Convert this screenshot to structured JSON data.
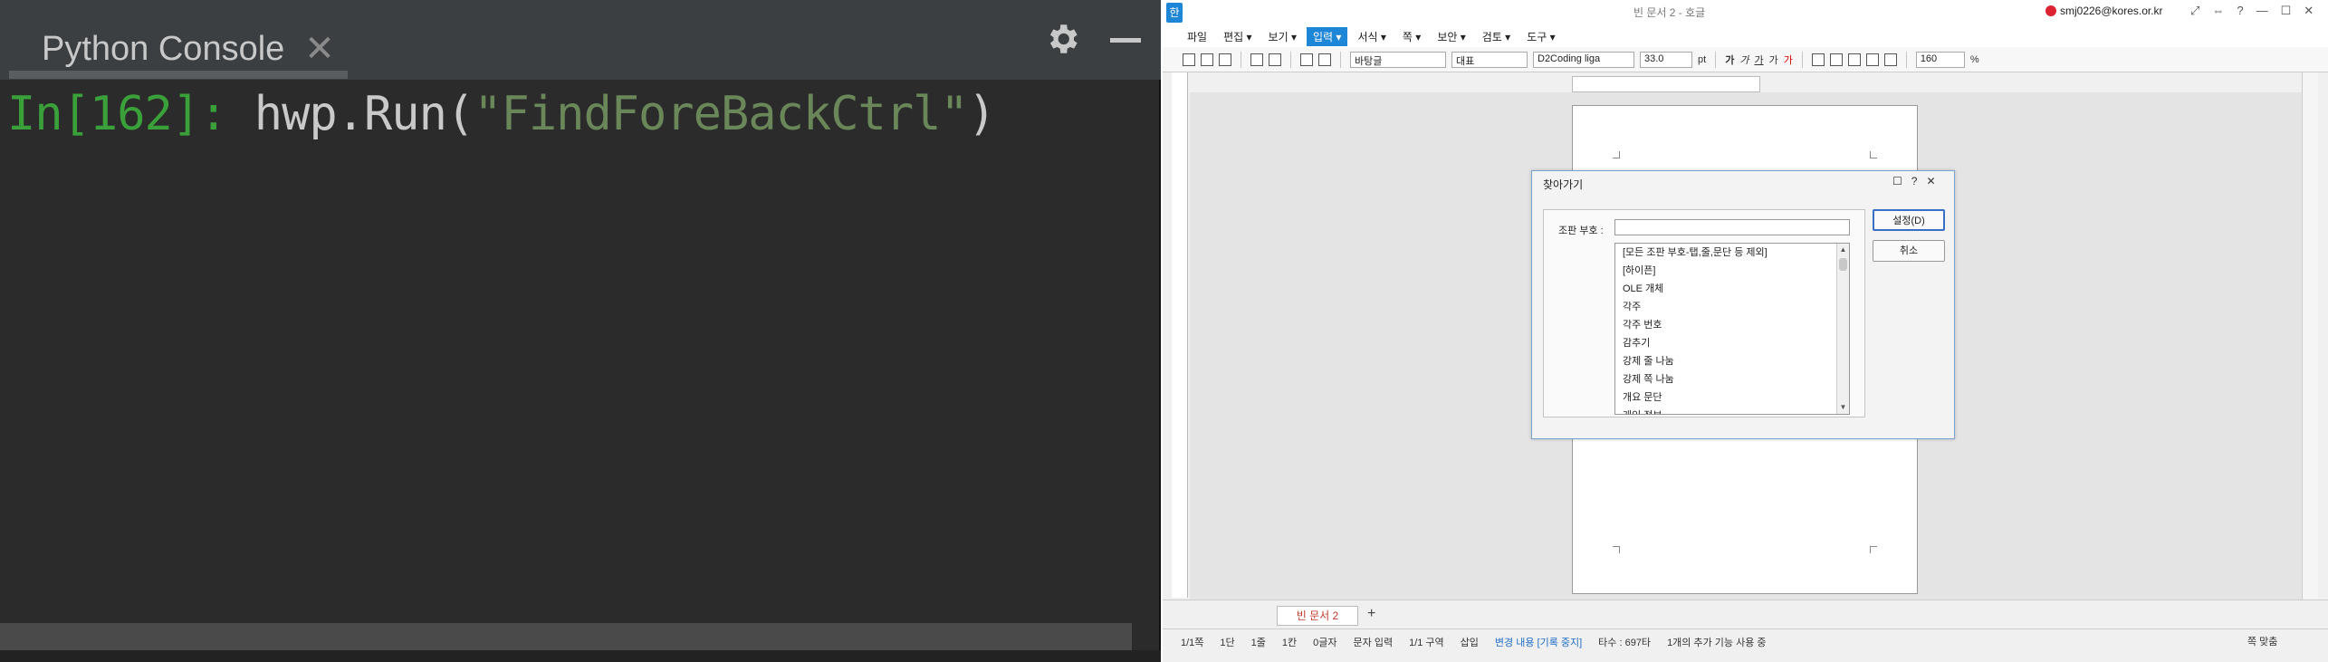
{
  "console": {
    "tab_title": "Python Console",
    "tab_close": "✕",
    "prompt": "In[162]:",
    "code_call": " hwp.Run(",
    "code_string": "\"FindForeBackCtrl\"",
    "code_close": ")"
  },
  "hwp": {
    "logo": "한",
    "doc_title": "빈 문서 2 - 호글",
    "user_email": "smj0226@kores.or.kr",
    "window_buttons": [
      "⤢",
      "⇔",
      "?",
      "—",
      "☐",
      "✕"
    ],
    "menus": [
      {
        "label": "파일"
      },
      {
        "label": "편집 ▾"
      },
      {
        "label": "보기 ▾"
      },
      {
        "label": "입력 ▾"
      },
      {
        "label": "서식 ▾"
      },
      {
        "label": "쪽 ▾"
      },
      {
        "label": "보안 ▾"
      },
      {
        "label": "검토 ▾"
      },
      {
        "label": "도구 ▾"
      }
    ],
    "toolbar": {
      "style": "바탕글",
      "lang": "대표",
      "font": "D2Coding liga",
      "font_size": "33.0",
      "font_unit": "pt",
      "format_labels": [
        "가",
        "가",
        "가",
        "가",
        "가"
      ],
      "zoom": "160",
      "zoom_unit": "%"
    },
    "tab": {
      "doc_tab": "빈 문서 2",
      "add_tab": "+"
    },
    "status": [
      "1/1쪽",
      "1단",
      "1줄",
      "1칸",
      "0글자",
      "문자 입력",
      "1/1 구역",
      "삽입",
      "변경 내용 [기록 중지]",
      "타수 : 697타",
      "1개의 추가 기능 사용 중"
    ],
    "zoom_fit": "쪽 맞춤"
  },
  "dialog": {
    "title": "찾아가기",
    "header_buttons": [
      "☐",
      "?",
      "✕"
    ],
    "label": "조판 부호 :",
    "input_value": "",
    "items": [
      "[모든 조판 부호-탭,줄,문단 등 제외]",
      "[하이픈]",
      "OLE 개체",
      "각주",
      "각주 번호",
      "감추기",
      "강제 줄 나눔",
      "강제 쪽 나눔",
      "개요 문단",
      "개인 정보"
    ],
    "ok": "설정(D)",
    "cancel": "취소"
  }
}
